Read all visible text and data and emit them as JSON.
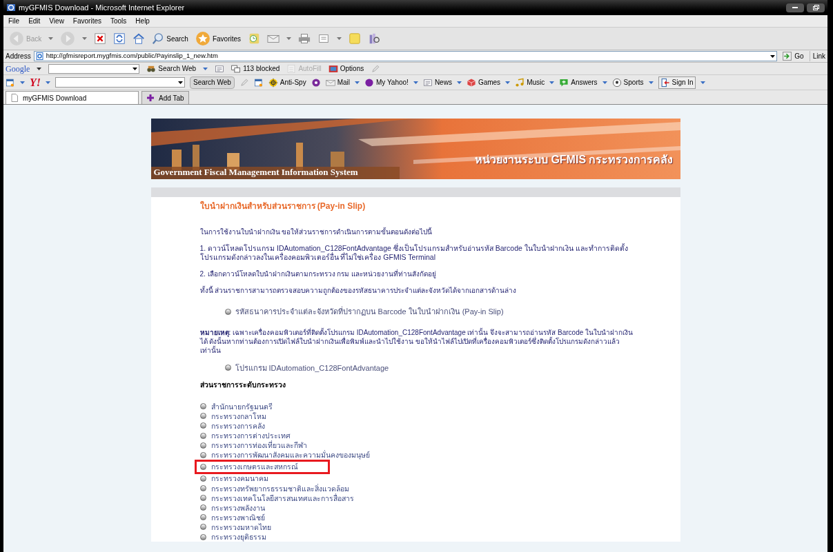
{
  "window": {
    "title": "myGFMIS Download - Microsoft Internet Explorer"
  },
  "menu": [
    "File",
    "Edit",
    "View",
    "Favorites",
    "Tools",
    "Help"
  ],
  "toolbar": [
    {
      "kind": "back",
      "label": "Back",
      "disabled": true
    },
    {
      "kind": "forward",
      "disabled": true
    },
    {
      "kind": "stop"
    },
    {
      "kind": "refresh"
    },
    {
      "kind": "home"
    },
    {
      "kind": "search",
      "label": "Search"
    },
    {
      "kind": "favorites",
      "label": "Favorites"
    },
    {
      "kind": "history"
    },
    {
      "kind": "mail"
    },
    {
      "kind": "print"
    },
    {
      "kind": "edit"
    },
    {
      "kind": "notes"
    },
    {
      "kind": "research"
    }
  ],
  "address": {
    "label": "Address",
    "url": "http://gfmisreport.mygfmis.com/public/Payinslip_1_new.htm",
    "go": "Go",
    "links": "Link"
  },
  "google_bar": {
    "logo": "Google",
    "items": [
      {
        "kind": "binoculars",
        "label": "Search Web"
      },
      {
        "kind": "news"
      },
      {
        "kind": "popup",
        "label": "113 blocked"
      },
      {
        "kind": "autofill",
        "label": "AutoFill",
        "disabled": true
      },
      {
        "kind": "options",
        "label": "Options"
      },
      {
        "kind": "pen"
      }
    ]
  },
  "yahoo_bar": {
    "logo": "Y!",
    "search_button": "Search Web",
    "items": [
      {
        "kind": "pen"
      },
      {
        "kind": "window"
      },
      {
        "kind": "antispy",
        "label": "Anti-Spy"
      },
      {
        "kind": "circle"
      },
      {
        "kind": "mail",
        "label": "Mail"
      },
      {
        "kind": "myyahoo",
        "label": "My Yahoo!"
      },
      {
        "kind": "news",
        "label": "News"
      },
      {
        "kind": "games",
        "label": "Games"
      },
      {
        "kind": "music",
        "label": "Music"
      },
      {
        "kind": "answers",
        "label": "Answers"
      },
      {
        "kind": "sports",
        "label": "Sports"
      },
      {
        "kind": "signin",
        "label": "Sign In"
      }
    ]
  },
  "tabs": [
    {
      "label": "myGFMIS Download",
      "selected": true
    },
    {
      "label": "Add Tab",
      "selected": false
    }
  ],
  "banner": {
    "subtitle": "Government Fiscal Management Information System",
    "title": "หน่วยงานระบบ GFMIS กระทรวงการคลัง"
  },
  "content": {
    "heading": "ใบนำฝากเงินสำหรับส่วนราชการ (Pay-in Slip)",
    "paragraphs": [
      "ในการใช้งานใบนำฝากเงิน ขอให้ส่วนราชการดำเนินการตามขั้นตอนดังต่อไปนี้",
      "1. ดาวน์โหลดโปรแกรม IDAutomation_C128FontAdvantage ซึ่งเป็นโปรแกรมสำหรับอ่านรหัส Barcode ในใบนำฝากเงิน และทำการติดตั้งโปรแกรมดังกล่าวลงในเครื่องคอมพิวเตอร์อื่น ที่ไม่ใช่เครื่อง GFMIS Terminal",
      "2. เลือกดาวน์โหลดใบนำฝากเงินตามกระทรวง กรม และหน่วยงานที่ท่านสังกัดอยู่",
      "ทั้งนี้ ส่วนราชการสามารถตรวจสอบความถูกต้องของรหัสธนาคารประจำแต่ละจังหวัดได้จากเอกสารด้านล่าง"
    ],
    "link_1": "รหัสธนาคารประจำแต่ละจังหวัดที่ปรากฏบน Barcode ในใบนำฝากเงิน (Pay-in Slip)",
    "note": "**หมายเหตุ**: เฉพาะเครื่องคอมพิวเตอร์ที่ติดตั้งโปรแกรม IDAutomation_C128FontAdvantage เท่านั้น จึงจะสามารถอ่านรหัส Barcode ในใบนำฝากเงินได้ ดังนั้นหากท่านต้องการเปิดไฟล์ใบนำฝากเงินเพื่อพิมพ์และนำไปใช้งาน ขอให้นำไฟล์ไปเปิดที่เครื่องคอมพิวเตอร์ซึ่งติดตั้งโปรแกรมดังกล่าวแล้วเท่านั้น",
    "link_2": "โปรแกรม IDAutomation_C128FontAdvantage",
    "section_title": "ส่วนราชการระดับกระทรวง",
    "ministries": [
      {
        "label": "สำนักนายกรัฐมนตรี",
        "highlighted": false
      },
      {
        "label": "กระทรวงกลาโหม",
        "highlighted": false
      },
      {
        "label": "กระทรวงการคลัง",
        "highlighted": false
      },
      {
        "label": "กระทรวงการต่างประเทศ",
        "highlighted": false
      },
      {
        "label": "กระทรวงการท่องเที่ยวและกีฬา",
        "highlighted": false
      },
      {
        "label": "กระทรวงการพัฒนาสังคมและความมั่นคงของมนุษย์",
        "highlighted": false
      },
      {
        "label": "กระทรวงเกษตรและสหกรณ์",
        "highlighted": true
      },
      {
        "label": "กระทรวงคมนาคม",
        "highlighted": false
      },
      {
        "label": "กระทรวงทรัพยากรธรรมชาติและสิ่งแวดล้อม",
        "highlighted": false
      },
      {
        "label": "กระทรวงเทคโนโลยีสารสนเทศและการสื่อสาร",
        "highlighted": false
      },
      {
        "label": "กระทรวงพลังงาน",
        "highlighted": false
      },
      {
        "label": "กระทรวงพาณิชย์",
        "highlighted": false
      },
      {
        "label": "กระทรวงมหาดไทย",
        "highlighted": false
      },
      {
        "label": "กระทรวงยุติธรรม",
        "highlighted": false
      }
    ]
  }
}
